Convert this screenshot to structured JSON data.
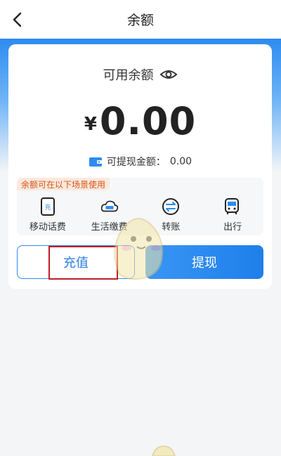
{
  "header": {
    "title": "余额",
    "back_icon": "chevron-left-icon"
  },
  "balance": {
    "label": "可用余额",
    "currency_symbol": "¥",
    "amount": "0.00",
    "visibility_icon": "eye-icon",
    "withdrawable_label": "可提现金额：",
    "withdrawable_amount": "0.00"
  },
  "scenes": {
    "tag": "余额可在以下场景使用",
    "items": [
      {
        "label": "移动话费",
        "icon": "mobile-recharge-icon"
      },
      {
        "label": "生活缴费",
        "icon": "utility-bill-icon"
      },
      {
        "label": "转账",
        "icon": "transfer-icon"
      },
      {
        "label": "出行",
        "icon": "bus-icon"
      }
    ]
  },
  "actions": {
    "recharge": "充值",
    "withdraw": "提现"
  },
  "colors": {
    "accent": "#2d8cf0",
    "tag_text": "#d2551e",
    "tag_bg": "#fde9dc",
    "highlight": "#c01d24"
  }
}
